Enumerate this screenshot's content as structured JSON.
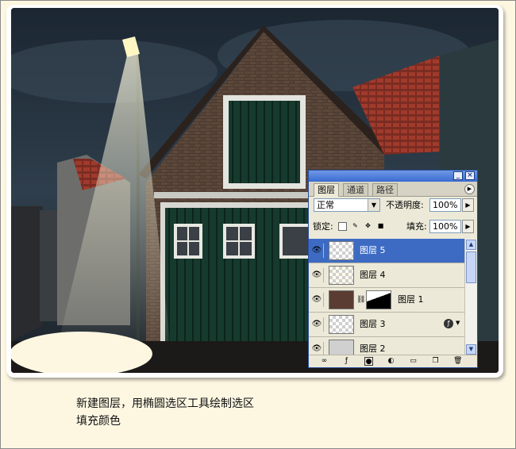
{
  "caption": {
    "line1": "新建图层，用椭圆选区工具绘制选区",
    "line2": "填充颜色"
  },
  "layers_panel": {
    "tabs": [
      "图层",
      "通道",
      "路径"
    ],
    "blend_mode": "正常",
    "opacity_label": "不透明度:",
    "opacity_value": "100%",
    "lock_label": "锁定:",
    "fill_label": "填充:",
    "fill_value": "100%",
    "layers": [
      {
        "name": "图层 5",
        "selected": true
      },
      {
        "name": "图层 4",
        "selected": false
      },
      {
        "name": "图层 1",
        "selected": false,
        "has_mask": true
      },
      {
        "name": "图层 3",
        "selected": false,
        "has_effect": true
      },
      {
        "name": "图层 2",
        "selected": false
      }
    ],
    "icons": [
      "link-icon",
      "layer-style-icon",
      "mask-icon",
      "adjustment-icon",
      "folder-icon",
      "new-layer-icon",
      "trash-icon"
    ]
  },
  "colors": {
    "page_bg": "#fdf7e2",
    "selection_blue": "#3d6bc4",
    "ellipse_fill": "#fdf7e2"
  }
}
